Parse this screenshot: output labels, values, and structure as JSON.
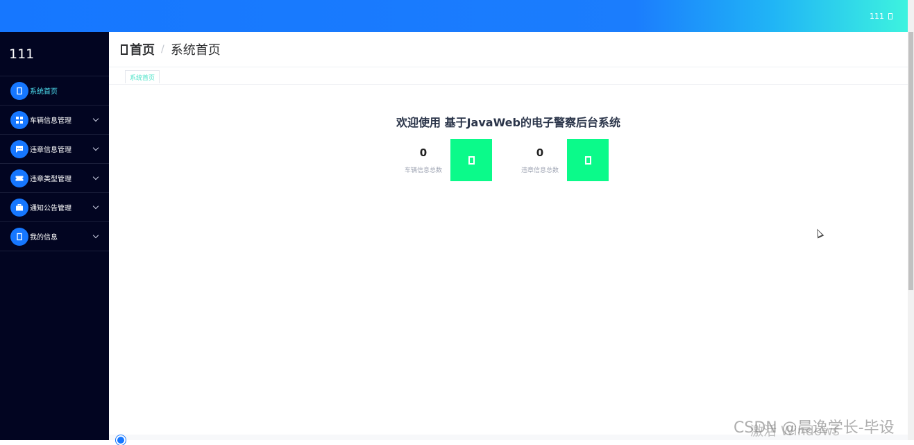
{
  "topbar": {
    "user": "111"
  },
  "sidebar": {
    "brand": "111",
    "items": [
      {
        "label": "系统首页",
        "icon": "home-icon",
        "active": true,
        "has_arrow": false
      },
      {
        "label": "车辆信息管理",
        "icon": "grid-icon",
        "active": false,
        "has_arrow": true
      },
      {
        "label": "违章信息管理",
        "icon": "chat-icon",
        "active": false,
        "has_arrow": true
      },
      {
        "label": "违章类型管理",
        "icon": "ticket-icon",
        "active": false,
        "has_arrow": true
      },
      {
        "label": "通知公告管理",
        "icon": "briefcase-icon",
        "active": false,
        "has_arrow": true
      },
      {
        "label": "我的信息",
        "icon": "user-icon",
        "active": false,
        "has_arrow": true
      }
    ]
  },
  "breadcrumb": {
    "home": "首页",
    "separator": "/",
    "current": "系统首页"
  },
  "tags": [
    {
      "label": "系统首页"
    }
  ],
  "welcome": "欢迎使用 基于JavaWeb的电子警察后台系统",
  "stats": [
    {
      "value": "0",
      "label": "车辆信息总数",
      "icon": "stat-icon"
    },
    {
      "value": "0",
      "label": "违章信息总数",
      "icon": "stat-icon"
    }
  ],
  "watermark": {
    "activate": "激活 Windows",
    "csdn": "CSDN @晨逸学长-毕设"
  },
  "colors": {
    "primary": "#1677ff",
    "sidebar_bg": "#020521",
    "accent_green": "#0bfa8a",
    "active_text": "#4ee3f3"
  }
}
